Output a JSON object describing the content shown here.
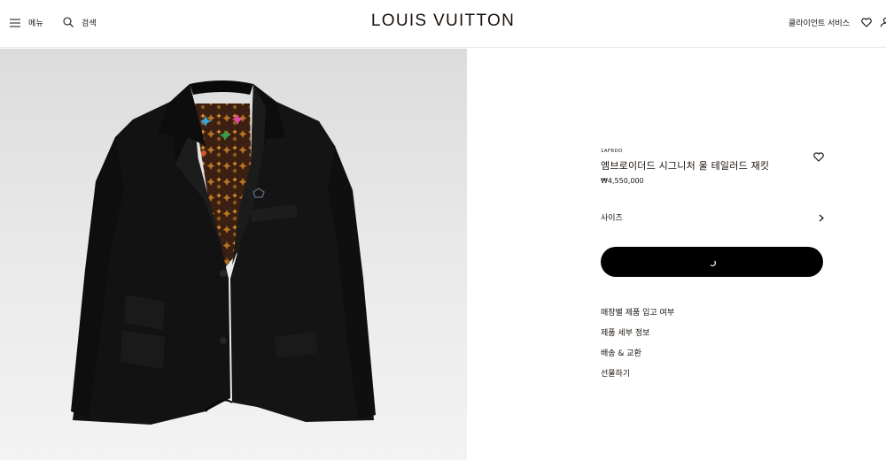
{
  "header": {
    "menu_label": "메뉴",
    "search_label": "검색",
    "brand": "LOUIS VUITTON",
    "client_services": "클라이언트 서비스"
  },
  "product": {
    "sku": "1AFRDO",
    "title": "엠브로이더드 시그니처 울 테일러드 재킷",
    "price": "₩4,550,000",
    "size_label": "사이즈"
  },
  "links": [
    "매장별 제품 입고 여부",
    "제품 세부 정보",
    "배송 & 교환",
    "선물하기"
  ],
  "colors": {
    "cta_background": "#000000",
    "text": "#19110b"
  }
}
